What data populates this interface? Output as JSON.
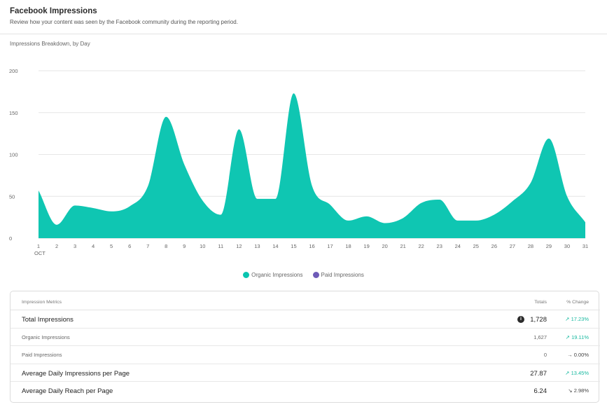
{
  "header": {
    "title": "Facebook Impressions",
    "subtitle": "Review how your content was seen by the Facebook community during the reporting period."
  },
  "chart_title": "Impressions Breakdown, by Day",
  "chart_data": {
    "type": "area",
    "x": [
      1,
      2,
      3,
      4,
      5,
      6,
      7,
      8,
      9,
      10,
      11,
      12,
      13,
      14,
      15,
      16,
      17,
      18,
      19,
      20,
      21,
      22,
      23,
      24,
      25,
      26,
      27,
      28,
      29,
      30,
      31
    ],
    "x_sublabel": "OCT",
    "series": [
      {
        "name": "Organic Impressions",
        "color": "#0ac5b0",
        "values": [
          57,
          16,
          39,
          36,
          32,
          38,
          62,
          145,
          88,
          45,
          28,
          130,
          47,
          47,
          173,
          63,
          40,
          21,
          26,
          18,
          24,
          42,
          46,
          21,
          21,
          28,
          44,
          66,
          119,
          50,
          19
        ]
      },
      {
        "name": "Paid Impressions",
        "color": "#6e5bb8",
        "values": [
          0,
          0,
          0,
          0,
          0,
          0,
          0,
          0,
          0,
          0,
          0,
          0,
          0,
          0,
          0,
          0,
          0,
          0,
          0,
          0,
          0,
          0,
          0,
          0,
          0,
          0,
          0,
          0,
          0,
          0,
          0
        ]
      }
    ],
    "yticks": [
      0,
      50,
      100,
      150,
      200
    ],
    "ylim": [
      0,
      200
    ],
    "grid": true,
    "legend_position": "bottom"
  },
  "legend": [
    {
      "label": "Organic Impressions",
      "color": "#0ac5b0"
    },
    {
      "label": "Paid Impressions",
      "color": "#6e5bb8"
    }
  ],
  "table": {
    "headers": {
      "metric": "Impression Metrics",
      "totals": "Totals",
      "change": "% Change"
    },
    "rows": [
      {
        "label": "Total Impressions",
        "total": "1,728",
        "change": "17.23%",
        "dir": "up",
        "emphasis": true,
        "info": true
      },
      {
        "label": "Organic Impressions",
        "total": "1,627",
        "change": "19.11%",
        "dir": "up",
        "emphasis": false
      },
      {
        "label": "Paid Impressions",
        "total": "0",
        "change": "0.00%",
        "dir": "flat",
        "emphasis": false
      },
      {
        "label": "Average Daily Impressions per Page",
        "total": "27.87",
        "change": "13.45%",
        "dir": "up",
        "emphasis": true
      },
      {
        "label": "Average Daily Reach per Page",
        "total": "6.24",
        "change": "2.98%",
        "dir": "down",
        "emphasis": true
      }
    ]
  }
}
